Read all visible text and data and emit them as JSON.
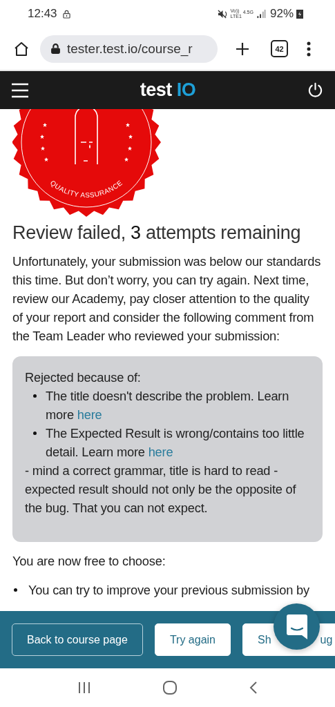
{
  "status_bar": {
    "time": "12:43",
    "network_labels": [
      "Vo))",
      "LTE1",
      "4.5G"
    ],
    "battery": "92%"
  },
  "browser": {
    "url": "tester.test.io/course_r",
    "tab_count": "42"
  },
  "app_bar": {
    "logo": {
      "word": "test",
      "mark": "IO"
    }
  },
  "badge": {
    "text": "QUALITY ASSURANCE"
  },
  "heading": {
    "before": "Review failed, ",
    "count": "3",
    "after": " attempts remaining"
  },
  "intro": "Unfortunately, your submission was below our standards this time. But don’t worry, you can try again. Next time, review our Academy, pay closer attention to the quality of your report and consider the following comment from the Team Leader who reviewed your submission:",
  "comment": {
    "title": "Rejected because of:",
    "items": [
      {
        "text": "The title doesn't describe the problem. Learn more ",
        "link": "here"
      },
      {
        "text": "The Expected Result is wrong/contains too little detail. Learn more ",
        "link": "here"
      }
    ],
    "note": "- mind a correct grammar, title is hard to read - expected result should not only be the opposite of the bug. That you can not expect."
  },
  "choices": {
    "title": "You are now free to choose:",
    "items": [
      "You can try to improve your previous submission by"
    ]
  },
  "footer": {
    "buttons": [
      {
        "kind": "outline",
        "label": "Back to course page"
      },
      {
        "kind": "solid",
        "label": "Try again"
      },
      {
        "kind": "covered",
        "label_start": "Sh",
        "label_end": "ug"
      }
    ]
  }
}
